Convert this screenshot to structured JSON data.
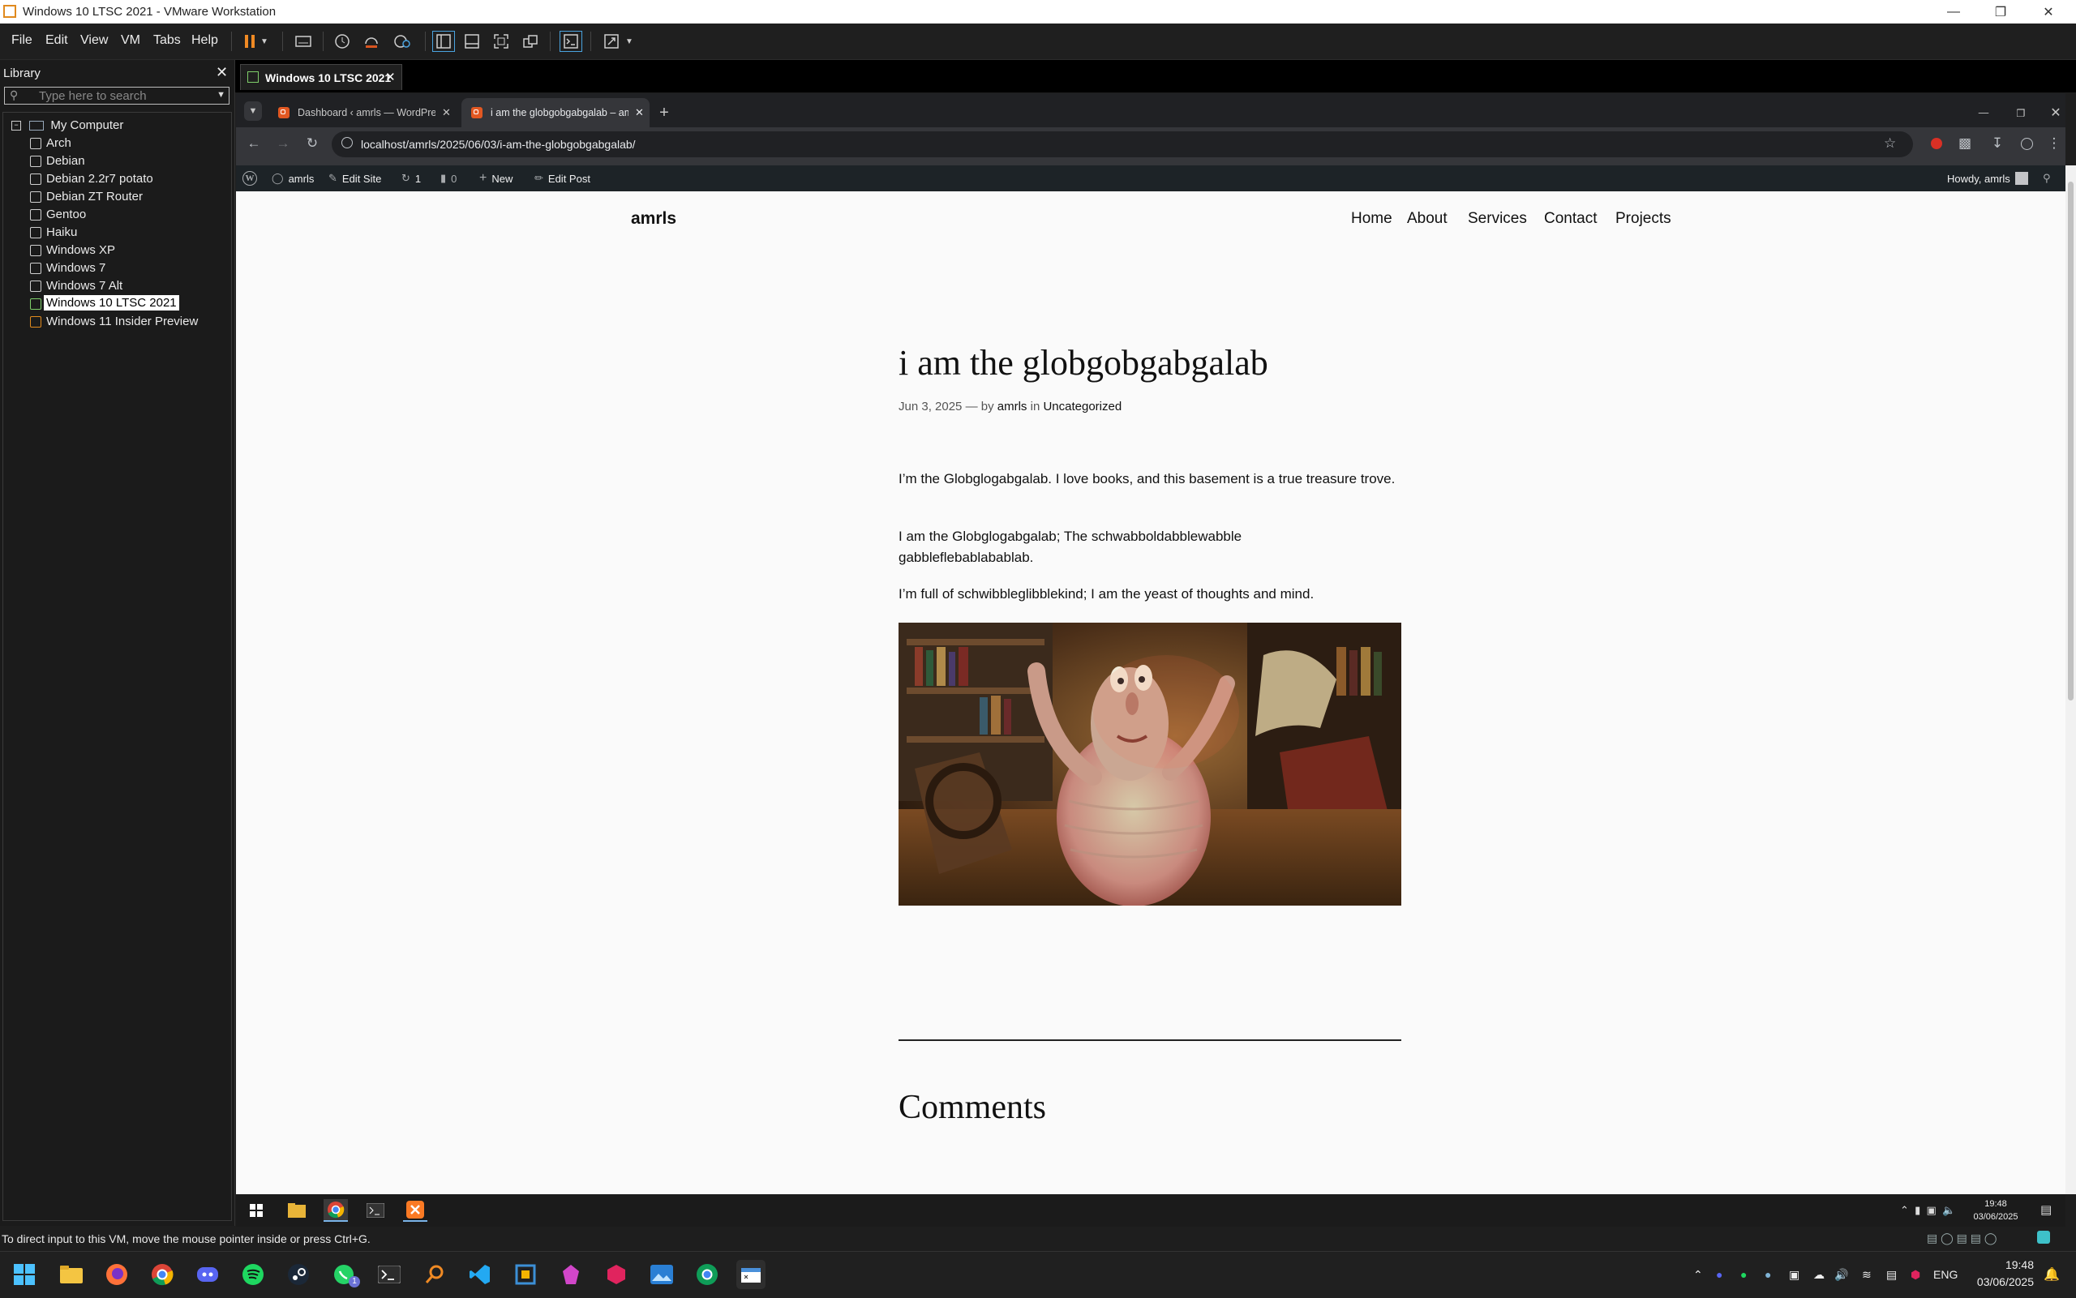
{
  "window": {
    "title": "Windows 10 LTSC 2021 - VMware Workstation"
  },
  "menu": [
    "File",
    "Edit",
    "View",
    "VM",
    "Tabs",
    "Help"
  ],
  "library": {
    "title": "Library",
    "search_placeholder": "Type here to search",
    "root": "My Computer",
    "items": [
      "Arch",
      "Debian",
      "Debian 2.2r7 potato",
      "Debian ZT Router",
      "Gentoo",
      "Haiku",
      "Windows XP",
      "Windows 7",
      "Windows 7 Alt",
      "Windows 10 LTSC 2021",
      "Windows 11 Insider Preview"
    ],
    "selected": "Windows 10 LTSC 2021"
  },
  "vm_tab": {
    "label": "Windows 10 LTSC 2021"
  },
  "browser": {
    "tabs": [
      {
        "label": "Dashboard ‹ amrls — WordPre…"
      },
      {
        "label": "i am the globgobgabgalab – am…"
      }
    ],
    "url": "localhost/amrls/2025/06/03/i-am-the-globgobgabgalab/"
  },
  "wp_admin_bar": {
    "site": "amrls",
    "edit_site": "Edit Site",
    "updates": "1",
    "comments": "0",
    "new": "New",
    "edit_post": "Edit Post",
    "howdy": "Howdy, amrls"
  },
  "page": {
    "site_title": "amrls",
    "nav": [
      "Home",
      "About",
      "Services",
      "Contact",
      "Projects"
    ],
    "post_title": "i am the globgobgabgalab",
    "meta": {
      "date": "Jun 3, 2025",
      "sep": "—",
      "by": "by",
      "author": "amrls",
      "in": "in",
      "category": "Uncategorized"
    },
    "paragraphs": [
      "I’m the Globglogabgalab. I love books, and this basement is a true treasure trove.",
      "I am the Globglogabgalab; The schwabboldabblewabble gabbleflebablabablab.",
      "I’m full of schwibbleglibblekind; I am the yeast of thoughts and mind."
    ],
    "comments_heading": "Comments"
  },
  "guest_tray": {
    "time": "19:48",
    "date": "03/06/2025"
  },
  "vm_status": "To direct input to this VM, move the mouse pointer inside or press Ctrl+G.",
  "host_tray": {
    "lang": "ENG",
    "time": "19:48",
    "date": "03/06/2025",
    "whatsapp_badge": "1"
  }
}
